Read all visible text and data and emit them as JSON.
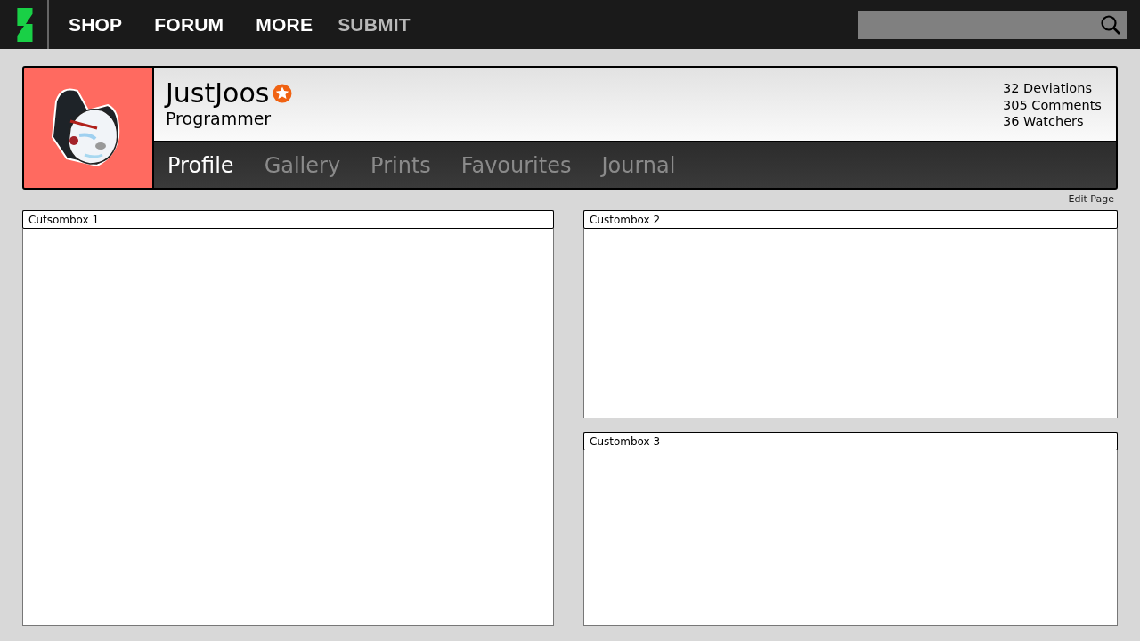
{
  "top_nav": {
    "items": [
      {
        "label": "SHOP",
        "selected": false
      },
      {
        "label": "FORUM",
        "selected": false
      },
      {
        "label": "MORE",
        "selected": false
      },
      {
        "label": "SUBMIT",
        "selected": true
      }
    ]
  },
  "profile": {
    "username": "JustJoos",
    "role": "Programmer",
    "stats": [
      "32 Deviations",
      "305 Comments",
      "36 Watchers"
    ],
    "tabs": [
      {
        "label": "Profile",
        "selected": true
      },
      {
        "label": "Gallery",
        "selected": false
      },
      {
        "label": "Prints",
        "selected": false
      },
      {
        "label": "Favourites",
        "selected": false
      },
      {
        "label": "Journal",
        "selected": false
      }
    ]
  },
  "edit_link": "Edit Page",
  "columns": [
    {
      "boxes": [
        {
          "title": "Cutsombox 1",
          "kind": "tall"
        }
      ]
    },
    {
      "boxes": [
        {
          "title": "Custombox 2",
          "kind": "short"
        },
        {
          "title": "Custombox 3",
          "kind": "short"
        }
      ]
    }
  ]
}
